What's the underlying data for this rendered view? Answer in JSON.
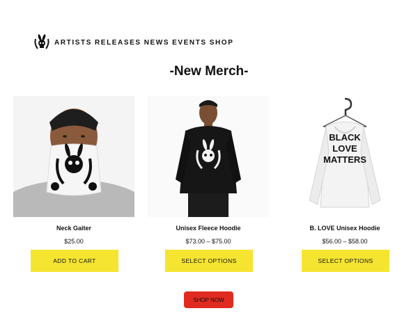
{
  "nav": {
    "logo_icon": "rabbit-skull-laurel-icon",
    "links": [
      "ARTISTS",
      "RELEASES",
      "NEWS",
      "EVENTS",
      "SHOP"
    ]
  },
  "section": {
    "title": "-New Merch-"
  },
  "products": [
    {
      "name": "Neck Gaiter",
      "price": "$25.00",
      "button": "ADD TO CART"
    },
    {
      "name": "Unisex Fleece Hoodie",
      "price": "$73.00 – $75.00",
      "button": "SELECT OPTIONS"
    },
    {
      "name": "B. LOVE Unisex Hoodie",
      "price": "$56.00 – $58.00",
      "button": "SELECT OPTIONS",
      "print": [
        "BLACK",
        "LOVE",
        "MATTERS"
      ]
    }
  ],
  "cta": {
    "label": "SHOP NOW"
  },
  "colors": {
    "button_yellow": "#f5e531",
    "shop_now_red": "#e02b20"
  }
}
